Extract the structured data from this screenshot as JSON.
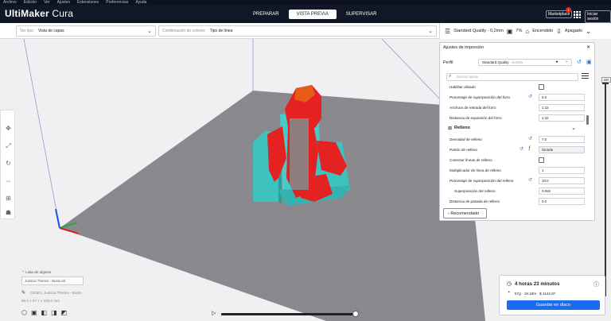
{
  "menu": [
    "Archivo",
    "Edición",
    "Ver",
    "Ajustes",
    "Extensiones",
    "Preferencias",
    "Ayuda"
  ],
  "app": {
    "brand": "UltiMaker",
    "product": "Cura"
  },
  "stages": [
    {
      "label": "PREPARAR",
      "active": false
    },
    {
      "label": "VISTA PREVIA",
      "active": true
    },
    {
      "label": "SUPERVISAR",
      "active": false
    }
  ],
  "header": {
    "marketplace": "Marketplace",
    "badge": "1",
    "signin": "Iniciar sesión"
  },
  "toolbar": {
    "view_type_label": "Ver tipo",
    "view_type_value": "Vista de capas",
    "color_scheme_label": "Combinación de colores",
    "color_scheme_value": "Tipo de línea"
  },
  "quality": {
    "profile": "Standard Quality - 0,2mm",
    "infill": "7%",
    "support": "Encendido",
    "adhesion": "Apagado"
  },
  "panel": {
    "title": "Ajustes de impresión",
    "profile_label": "Perfil",
    "profile_value": "Standard Quality",
    "profile_sub": "- 0.2mm",
    "search_placeholder": "Buscar ajuste",
    "rows": [
      {
        "name": "Habilitar alisado",
        "type": "checkbox",
        "italic": false
      },
      {
        "name": "Porcentaje de superposición del forro",
        "value": "5.0",
        "italic": true,
        "reset": true
      },
      {
        "name": "Anchura de retirada del forro",
        "value": "1.32",
        "italic": false
      },
      {
        "name": "Distancia de expansión del forro",
        "value": "1.32",
        "italic": false
      },
      {
        "name": "Relleno",
        "type": "section"
      },
      {
        "name": "Densidad de relleno",
        "value": "7.0",
        "italic": true,
        "reset": true
      },
      {
        "name": "Patrón de relleno",
        "value": "Giroide",
        "italic": true,
        "reset": true,
        "select": true
      },
      {
        "name": "Conectar líneas de relleno",
        "type": "checkbox",
        "italic": false
      },
      {
        "name": "Multiplicador de línea de relleno",
        "value": "1",
        "italic": false
      },
      {
        "name": "Porcentaje de superposición del relleno",
        "value": "10.0",
        "italic": true,
        "reset": true
      },
      {
        "name": "Superposición del relleno",
        "value": "0.063",
        "italic": false,
        "indent": true
      },
      {
        "name": "Distancia de pasada de relleno",
        "value": "0.0",
        "italic": false
      }
    ],
    "recommended": "Recomendado"
  },
  "objects": {
    "list_label": "Lista de objetos",
    "list_item": "Justicia Themis - Busto.stl",
    "name": "CE3E3_Justicia Themis - Busto",
    "dims": "66.6 x 57.7 x 100.0 mm"
  },
  "layer": {
    "top": "400"
  },
  "print": {
    "time": "4 horas 23 minutos",
    "material": "57g · 19.19m · $ 1144.97",
    "save": "Guardar en disco"
  }
}
